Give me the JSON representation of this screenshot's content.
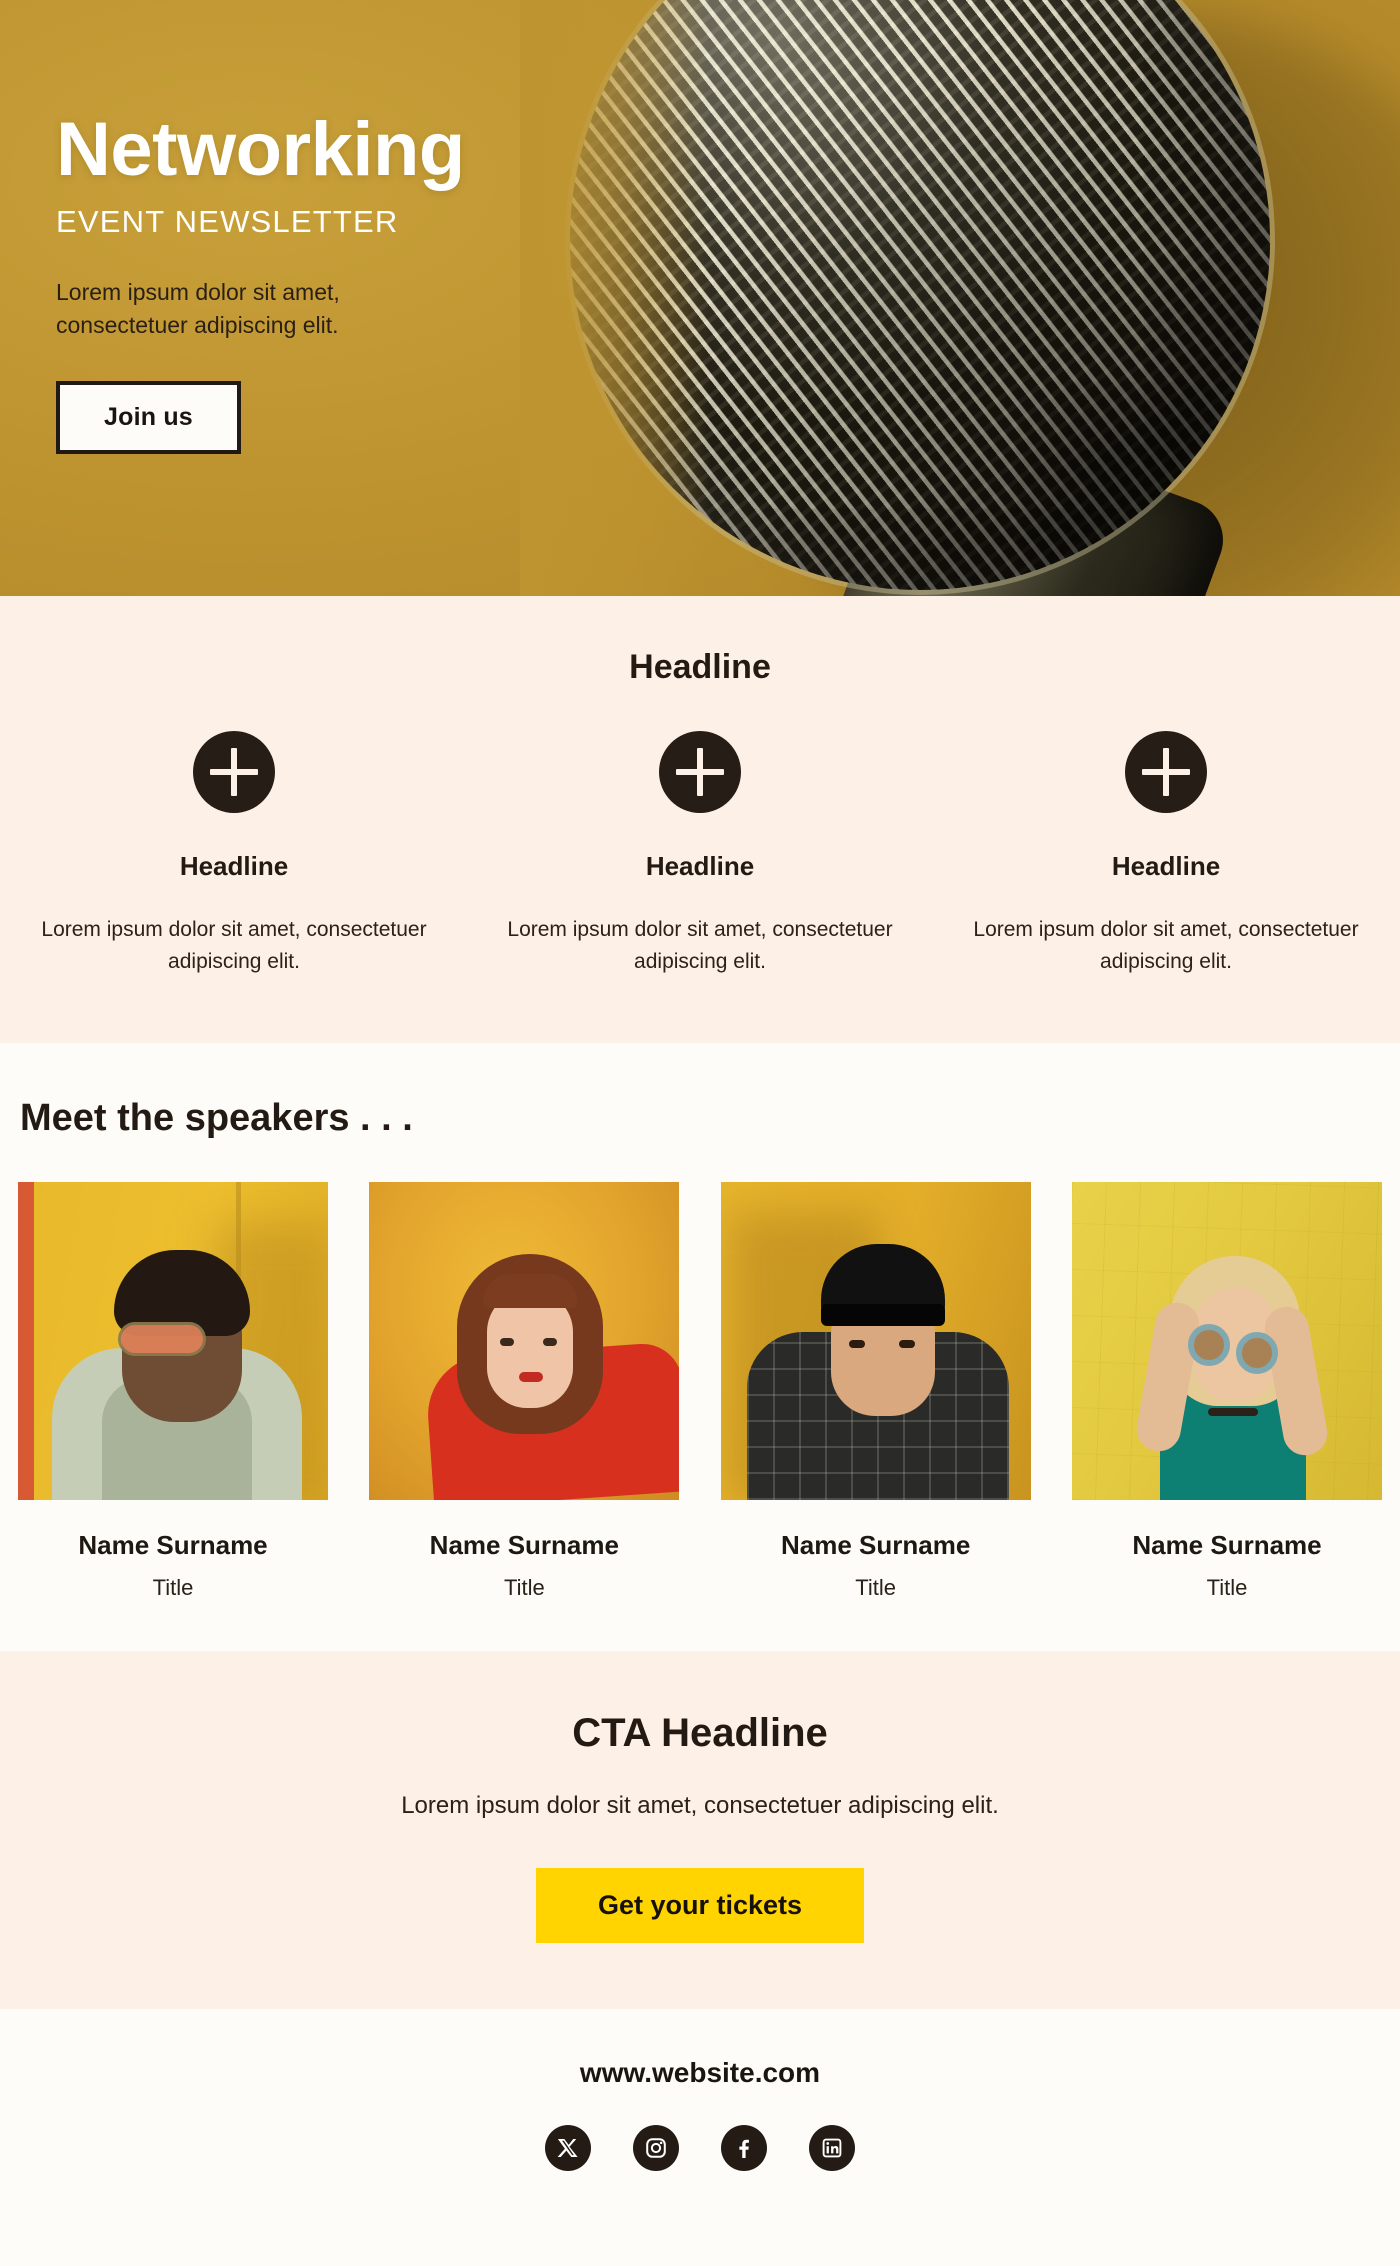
{
  "hero": {
    "title": "Networking",
    "subtitle": "EVENT NEWSLETTER",
    "body": "Lorem ipsum dolor sit amet, consectetuer adipiscing elit.",
    "button_label": "Join us",
    "background_color": "#BE9430",
    "image_alt": "microphone-photo"
  },
  "features": {
    "heading": "Headline",
    "background_color": "#FDF0E6",
    "items": [
      {
        "icon": "plus-circle-icon",
        "title": "Headline",
        "body": "Lorem ipsum dolor sit amet, consectetuer adipiscing elit."
      },
      {
        "icon": "plus-circle-icon",
        "title": "Headline",
        "body": "Lorem ipsum dolor sit amet, consectetuer adipiscing elit."
      },
      {
        "icon": "plus-circle-icon",
        "title": "Headline",
        "body": "Lorem ipsum dolor sit amet, consectetuer adipiscing elit."
      }
    ]
  },
  "speakers": {
    "heading": "Meet the speakers . . .",
    "background_color": "#FDFCF8",
    "items": [
      {
        "name": "Name Surname",
        "title": "Title",
        "photo_alt": "speaker-photo-1"
      },
      {
        "name": "Name Surname",
        "title": "Title",
        "photo_alt": "speaker-photo-2"
      },
      {
        "name": "Name Surname",
        "title": "Title",
        "photo_alt": "speaker-photo-3"
      },
      {
        "name": "Name Surname",
        "title": "Title",
        "photo_alt": "speaker-photo-4"
      }
    ]
  },
  "cta": {
    "heading": "CTA Headline",
    "body": "Lorem ipsum dolor sit amet, consectetuer adipiscing elit.",
    "button_label": "Get your tickets",
    "button_color": "#FFD400",
    "background_color": "#FDF0E6"
  },
  "footer": {
    "url": "www.website.com",
    "background_color": "#FDFCF8",
    "social": [
      {
        "name": "x-twitter-icon",
        "label": "X"
      },
      {
        "name": "instagram-icon",
        "label": "Instagram"
      },
      {
        "name": "facebook-icon",
        "label": "Facebook"
      },
      {
        "name": "linkedin-icon",
        "label": "LinkedIn"
      }
    ]
  }
}
